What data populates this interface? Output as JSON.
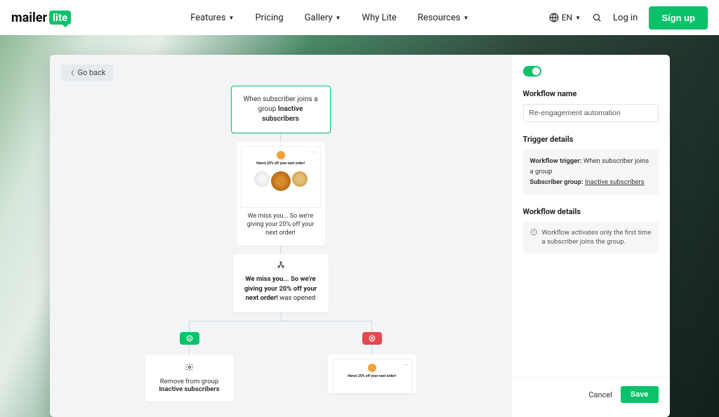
{
  "nav": {
    "brand_a": "mailer",
    "brand_b": "lite",
    "items": [
      "Features",
      "Pricing",
      "Gallery",
      "Why Lite",
      "Resources"
    ],
    "dropdowns": [
      true,
      false,
      true,
      false,
      true
    ],
    "lang": "EN",
    "login": "Log in",
    "signup": "Sign up"
  },
  "canvas": {
    "goback": "Go back",
    "trigger_line1": "When subscriber joins a group",
    "trigger_bold": "Inactive subscribers",
    "email_preview_header": "Here's 20% off your next order!",
    "email_caption": "We miss you... So we're giving your 20% off your next order!",
    "condition_bold": "We miss you... So we're giving your 20% off your next order!",
    "condition_tail": " was opened",
    "action_label": "Remove from group",
    "action_bold": "Inactive subscribers"
  },
  "panel": {
    "h_workflow_name": "Workflow name",
    "workflow_name_value": "Re-engagement automation",
    "h_trigger": "Trigger details",
    "trigger_k": "Workflow trigger:",
    "trigger_v": "When subscriber joins a group",
    "group_k": "Subscriber group:",
    "group_v": "Inactive subscribers",
    "h_details": "Workflow details",
    "info": "Workflow activates only the first time a subscriber joins the group.",
    "cancel": "Cancel",
    "save": "Save"
  }
}
